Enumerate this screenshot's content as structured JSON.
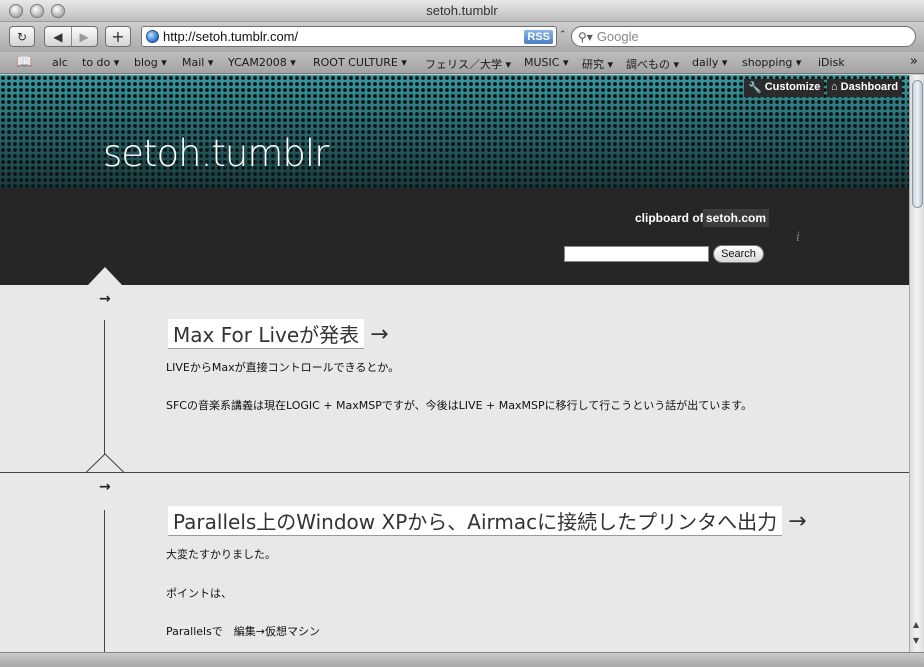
{
  "window": {
    "title": "setoh.tumblr"
  },
  "toolbar": {
    "url": "http://setoh.tumblr.com/",
    "rss_label": "RSS",
    "search_placeholder": "Google",
    "add_label": "+"
  },
  "bookmarks": {
    "items": [
      "alc",
      "to do ▾",
      "blog ▾",
      "Mail ▾",
      "YCAM2008 ▾",
      "ROOT CULTURE ▾",
      "フェリス／大学 ▾",
      "MUSIC ▾",
      "研究 ▾",
      "調べもの ▾",
      "daily ▾",
      "shopping ▾",
      "iDisk"
    ],
    "more": "»"
  },
  "admin": {
    "customize": "Customize",
    "dashboard": "Dashboard"
  },
  "site": {
    "title": "setoh.tumblr",
    "clipboard_label": "clipboard of",
    "clipboard_link": "setoh.com",
    "search_button": "Search"
  },
  "posts": [
    {
      "title": "Max For Liveが発表",
      "lines": [
        "LIVEからMaxが直接コントロールできるとか。",
        "SFCの音楽系講義は現在LOGIC + MaxMSPですが、今後はLIVE + MaxMSPに移行して行こうという話が出ています。"
      ]
    },
    {
      "title": "Parallels上のWindow XPから、Airmacに接続したプリンタへ出力",
      "lines": [
        "大変たすかりました。",
        "ポイントは、",
        "Parallelsで　編集→仮想マシン"
      ]
    }
  ],
  "icons": {
    "arrow": "→"
  }
}
